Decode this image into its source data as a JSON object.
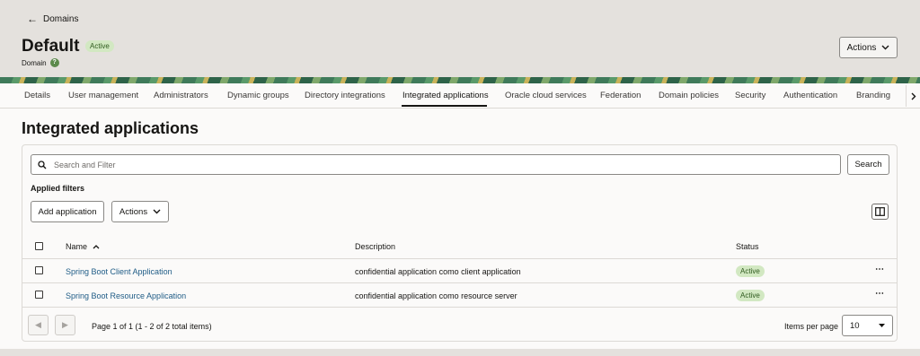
{
  "header": {
    "back_label": "Domains",
    "title": "Default",
    "status": "Active",
    "subtitle": "Domain",
    "help_icon": "question-icon",
    "actions_label": "Actions"
  },
  "tabs": [
    {
      "label": "Details"
    },
    {
      "label": "User management"
    },
    {
      "label": "Administrators"
    },
    {
      "label": "Dynamic groups"
    },
    {
      "label": "Directory integrations"
    },
    {
      "label": "Integrated applications",
      "active": true
    },
    {
      "label": "Oracle cloud services"
    },
    {
      "label": "Federation"
    },
    {
      "label": "Domain policies"
    },
    {
      "label": "Security"
    },
    {
      "label": "Authentication"
    },
    {
      "label": "Branding"
    }
  ],
  "main": {
    "title": "Integrated applications",
    "search_placeholder": "Search and Filter",
    "search_button": "Search",
    "applied_filters": "Applied filters",
    "add_button": "Add application",
    "actions_button": "Actions"
  },
  "table": {
    "columns": {
      "name": "Name",
      "description": "Description",
      "status": "Status"
    },
    "rows": [
      {
        "name": "Spring Boot Client Application",
        "description": "confidential application como client application",
        "status": "Active"
      },
      {
        "name": "Spring Boot Resource Application",
        "description": "confidential application como resource server",
        "status": "Active"
      }
    ]
  },
  "pagination": {
    "summary": "Page 1 of 1 (1 - 2 of 2 total items)",
    "items_per_page_label": "Items per page",
    "items_per_page": "10"
  },
  "colors": {
    "accent_link": "#1f5c86",
    "status_active_bg": "#d2e8c2",
    "header_bg": "#e4e1dd"
  }
}
